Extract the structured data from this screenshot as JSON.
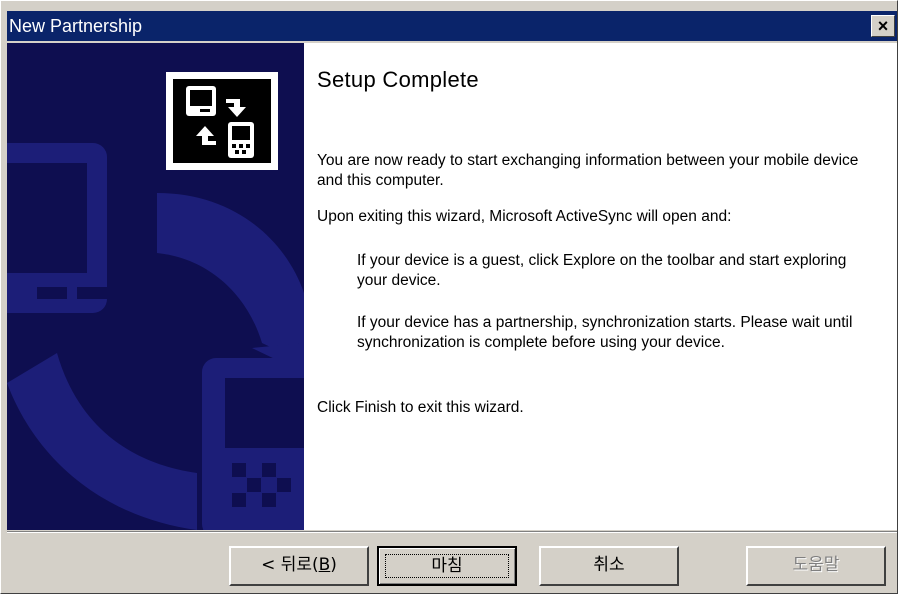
{
  "window": {
    "title": "New Partnership",
    "close_label": "×"
  },
  "main": {
    "heading": "Setup Complete",
    "paragraphs": {
      "intro": "You are now ready to start exchanging information between your mobile device and this computer.",
      "exit": "Upon exiting this wizard, Microsoft ActiveSync will open and:",
      "guest": "If your device is a guest, click Explore on the toolbar and start exploring your device.",
      "partnership": "If your device has a partnership, synchronization starts. Please wait until synchronization is complete before using your device.",
      "finish": "Click Finish to exit this wizard."
    }
  },
  "buttons": {
    "back_prefix": "< 뒤로(",
    "back_mnemonic": "B",
    "back_suffix": ")",
    "finish": "마침",
    "cancel": "취소",
    "help": "도움말"
  },
  "icons": {
    "sync": "device-sync-icon",
    "background": "wizard-sidebar-art"
  },
  "colors": {
    "titlebar": "#0a246a",
    "sidebar": "#0e0e50",
    "dialog_face": "#d4d0c8"
  }
}
